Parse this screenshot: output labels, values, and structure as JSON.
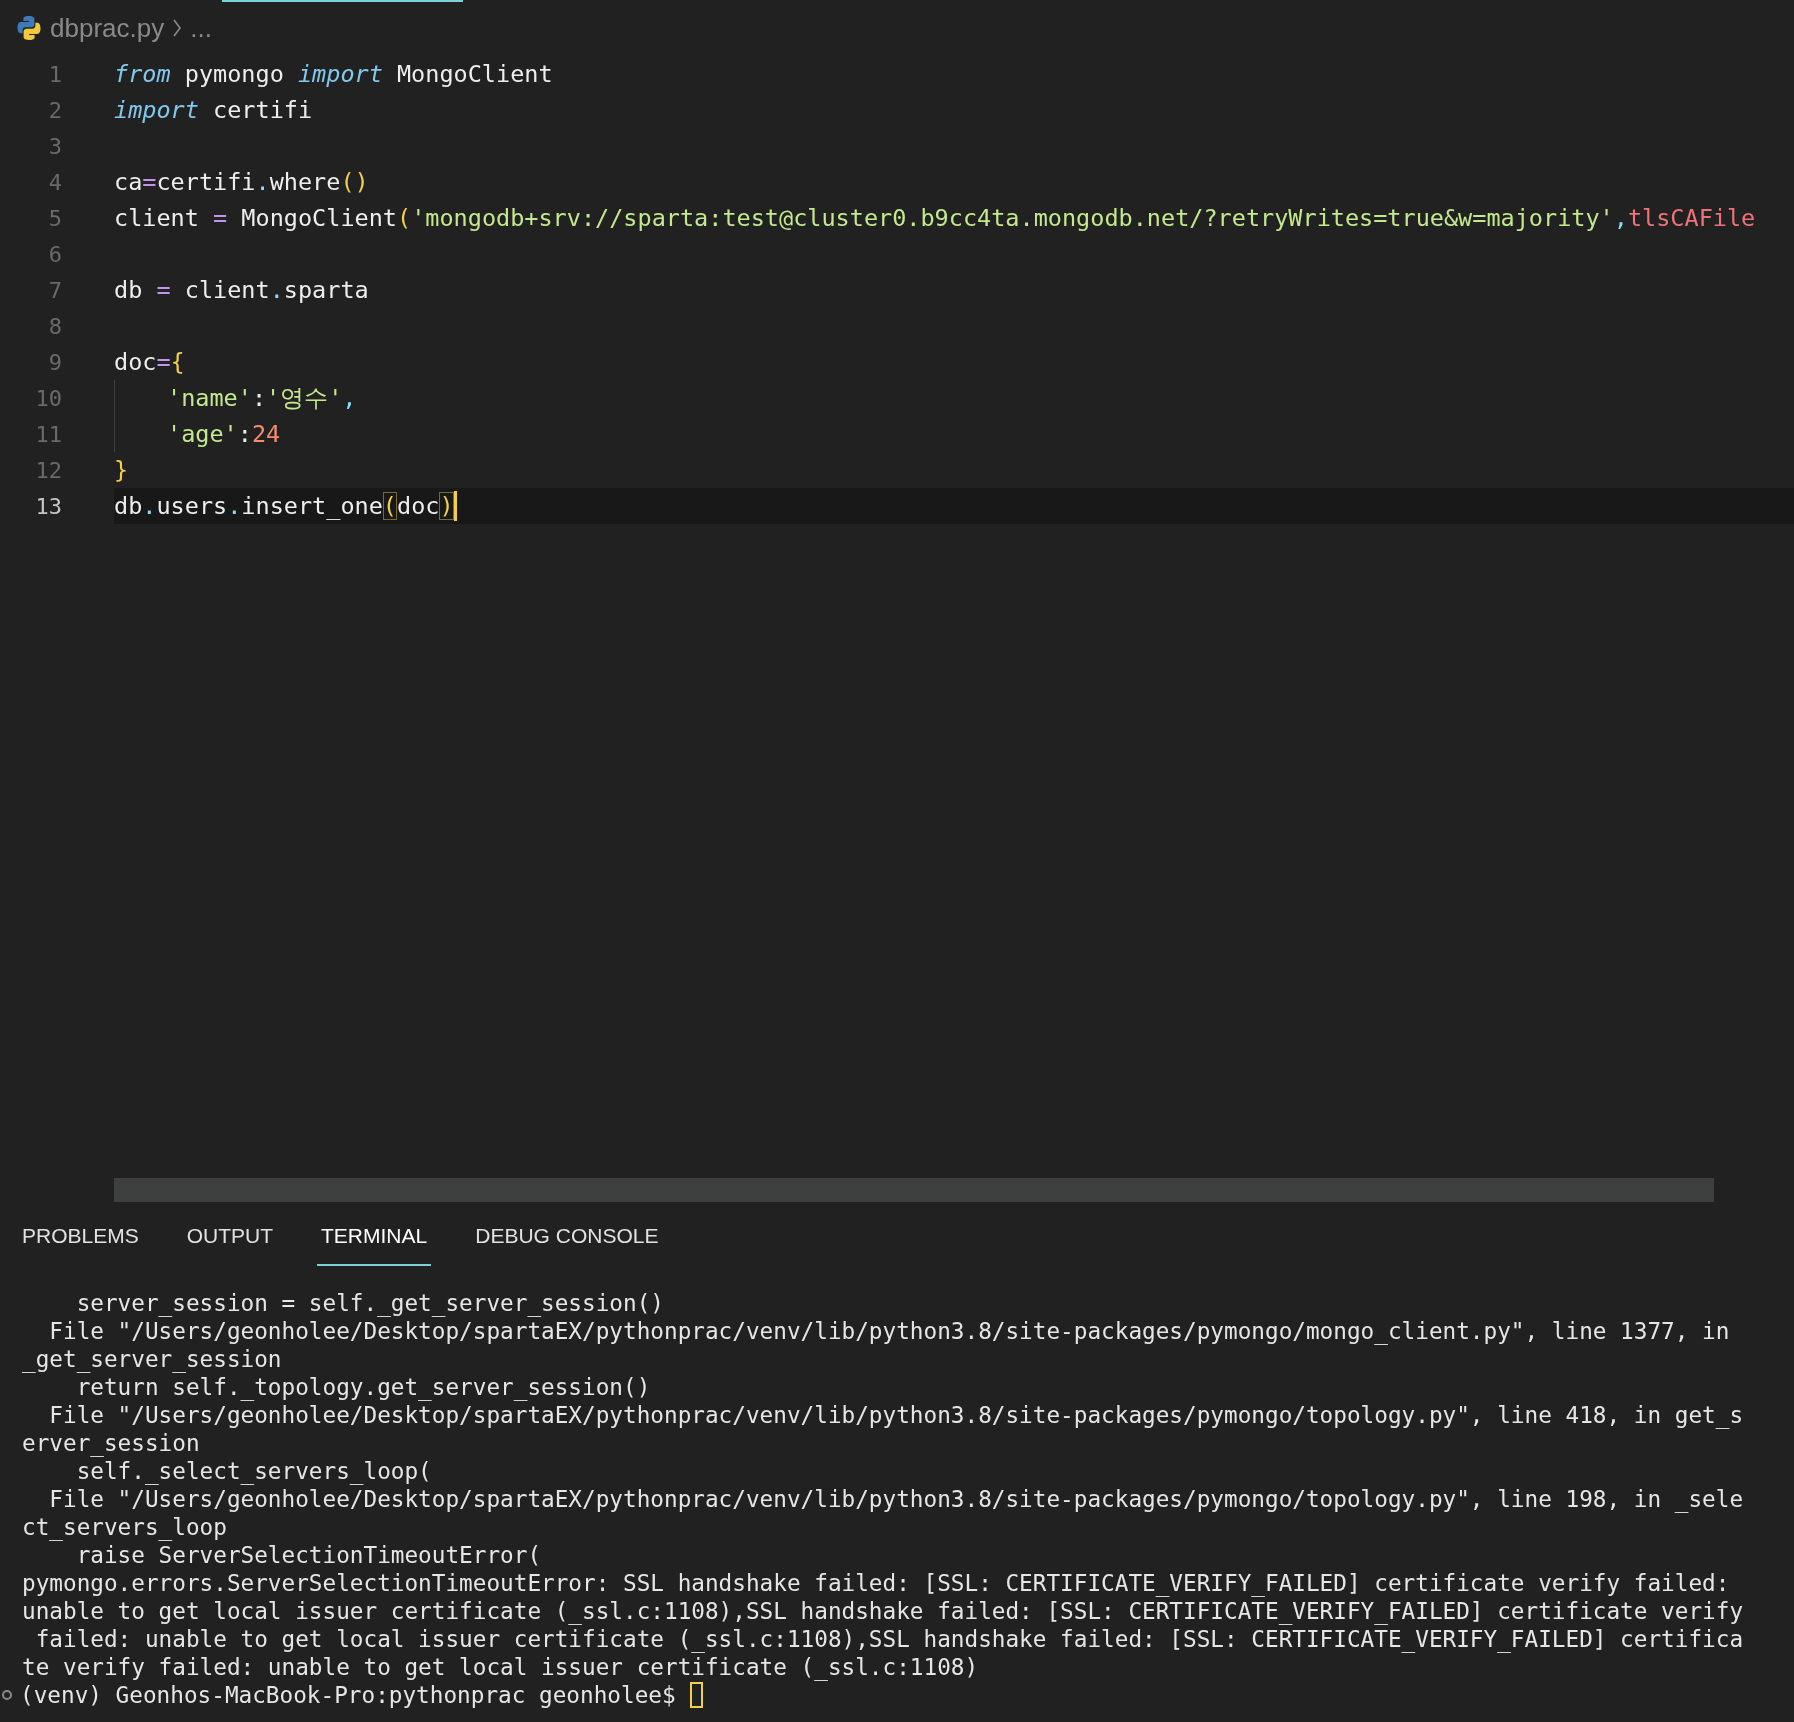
{
  "breadcrumb": {
    "file": "dbprac.py",
    "more": "..."
  },
  "editor": {
    "lines": [
      {
        "number": "1",
        "active": false,
        "cursor": false,
        "tokens": [
          {
            "kind": "keyword",
            "text": "from"
          },
          {
            "kind": "plain",
            "text": " pymongo "
          },
          {
            "kind": "keyword",
            "text": "import"
          },
          {
            "kind": "plain",
            "text": " MongoClient"
          }
        ]
      },
      {
        "number": "2",
        "active": false,
        "cursor": false,
        "tokens": [
          {
            "kind": "keyword",
            "text": "import"
          },
          {
            "kind": "plain",
            "text": " certifi"
          }
        ]
      },
      {
        "number": "3",
        "active": false,
        "cursor": false
      },
      {
        "number": "4",
        "active": false,
        "cursor": false,
        "tokens": [
          {
            "kind": "plain",
            "text": "ca"
          },
          {
            "kind": "operator",
            "text": "="
          },
          {
            "kind": "plain",
            "text": "certifi"
          },
          {
            "kind": "punct",
            "text": "."
          },
          {
            "kind": "plain",
            "text": "where"
          },
          {
            "kind": "bracket",
            "text": "()"
          }
        ]
      },
      {
        "number": "5",
        "active": false,
        "cursor": false,
        "tokens": [
          {
            "kind": "plain",
            "text": "client "
          },
          {
            "kind": "operator",
            "text": "="
          },
          {
            "kind": "plain",
            "text": " MongoClient"
          },
          {
            "kind": "bracket",
            "text": "("
          },
          {
            "kind": "string",
            "text": "'mongodb+srv://sparta:test@cluster0.b9cc4ta.mongodb.net/?retryWrites=true&w=majority'"
          },
          {
            "kind": "punct",
            "text": ","
          },
          {
            "kind": "param",
            "text": "tlsCAFile"
          }
        ]
      },
      {
        "number": "6",
        "active": false,
        "cursor": false
      },
      {
        "number": "7",
        "active": false,
        "cursor": false,
        "tokens": [
          {
            "kind": "plain",
            "text": "db "
          },
          {
            "kind": "operator",
            "text": "="
          },
          {
            "kind": "plain",
            "text": " client"
          },
          {
            "kind": "punct",
            "text": "."
          },
          {
            "kind": "plain",
            "text": "sparta"
          }
        ]
      },
      {
        "number": "8",
        "active": false,
        "cursor": false
      },
      {
        "number": "9",
        "active": false,
        "cursor": false,
        "tokens": [
          {
            "kind": "plain",
            "text": "doc"
          },
          {
            "kind": "operator",
            "text": "="
          },
          {
            "kind": "bracket",
            "text": "{"
          }
        ]
      },
      {
        "number": "10",
        "active": false,
        "cursor": false,
        "indented": true,
        "tokens": [
          {
            "kind": "string",
            "text": "'name'"
          },
          {
            "kind": "plain",
            "text": ":"
          },
          {
            "kind": "string",
            "text": "'영수'"
          },
          {
            "kind": "punct",
            "text": ","
          }
        ]
      },
      {
        "number": "11",
        "active": false,
        "cursor": false,
        "indented": true,
        "tokens": [
          {
            "kind": "string",
            "text": "'age'"
          },
          {
            "kind": "plain",
            "text": ":"
          },
          {
            "kind": "number",
            "text": "24"
          }
        ]
      },
      {
        "number": "12",
        "active": false,
        "cursor": false,
        "tokens": [
          {
            "kind": "bracket",
            "text": "}"
          }
        ]
      },
      {
        "number": "13",
        "active": true,
        "cursor": true,
        "tokens": [
          {
            "kind": "plain",
            "text": "db"
          },
          {
            "kind": "punct",
            "text": "."
          },
          {
            "kind": "plain",
            "text": "users"
          },
          {
            "kind": "punct",
            "text": "."
          },
          {
            "kind": "plain",
            "text": "insert_one"
          },
          {
            "kind": "matched",
            "text": "("
          },
          {
            "kind": "plain",
            "text": "doc"
          },
          {
            "kind": "matched",
            "text": ")"
          }
        ]
      }
    ]
  },
  "panel": {
    "tabs": [
      {
        "label": "PROBLEMS",
        "selected": false
      },
      {
        "label": "OUTPUT",
        "selected": false
      },
      {
        "label": "TERMINAL",
        "selected": true
      },
      {
        "label": "DEBUG CONSOLE",
        "selected": false
      }
    ],
    "terminal": {
      "lines": [
        "    server_session = self._get_server_session()",
        "  File \"/Users/geonholee/Desktop/spartaEX/pythonprac/venv/lib/python3.8/site-packages/pymongo/mongo_client.py\", line 1377, in",
        "_get_server_session",
        "    return self._topology.get_server_session()",
        "  File \"/Users/geonholee/Desktop/spartaEX/pythonprac/venv/lib/python3.8/site-packages/pymongo/topology.py\", line 418, in get_s",
        "erver_session",
        "    self._select_servers_loop(",
        "  File \"/Users/geonholee/Desktop/spartaEX/pythonprac/venv/lib/python3.8/site-packages/pymongo/topology.py\", line 198, in _sele",
        "ct_servers_loop",
        "    raise ServerSelectionTimeoutError(",
        "pymongo.errors.ServerSelectionTimeoutError: SSL handshake failed: [SSL: CERTIFICATE_VERIFY_FAILED] certificate verify failed:",
        "unable to get local issuer certificate (_ssl.c:1108),SSL handshake failed: [SSL: CERTIFICATE_VERIFY_FAILED] certificate verify",
        " failed: unable to get local issuer certificate (_ssl.c:1108),SSL handshake failed: [SSL: CERTIFICATE_VERIFY_FAILED] certifica",
        "te verify failed: unable to get local issuer certificate (_ssl.c:1108)"
      ],
      "prompt": "(venv) Geonhos-MacBook-Pro:pythonprac geonholee$"
    }
  }
}
